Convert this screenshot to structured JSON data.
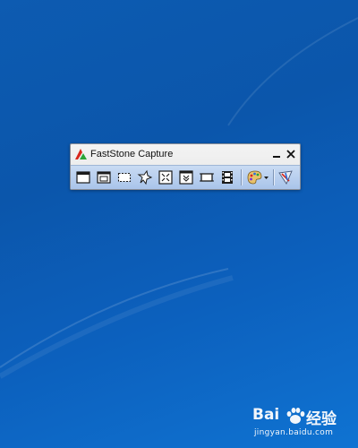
{
  "window": {
    "title": "FastStone Capture",
    "controls": [
      {
        "name": "minimize-icon",
        "kind": "minimize"
      },
      {
        "name": "close-icon",
        "kind": "close"
      }
    ]
  },
  "toolbar": {
    "tools": [
      {
        "icon": "capture-active-window-icon"
      },
      {
        "icon": "capture-window-object-icon"
      },
      {
        "icon": "capture-rectangular-region-icon"
      },
      {
        "icon": "capture-freehand-region-icon"
      },
      {
        "icon": "capture-full-screen-icon"
      },
      {
        "icon": "capture-scrolling-window-icon"
      },
      {
        "icon": "capture-fixed-region-icon"
      },
      {
        "icon": "screen-recorder-icon"
      },
      {
        "icon": "output-palette-dropdown-icon"
      },
      {
        "icon": "settings-menu-icon"
      }
    ]
  },
  "watermark": {
    "brand_left": "Bai",
    "brand_right": "经验",
    "url": "jingyan.baidu.com"
  },
  "colors": {
    "desktop": "#0b56ab",
    "toolbar_band": "#b7cdee",
    "logo_red": "#d8261b",
    "logo_green": "#2aa436"
  }
}
